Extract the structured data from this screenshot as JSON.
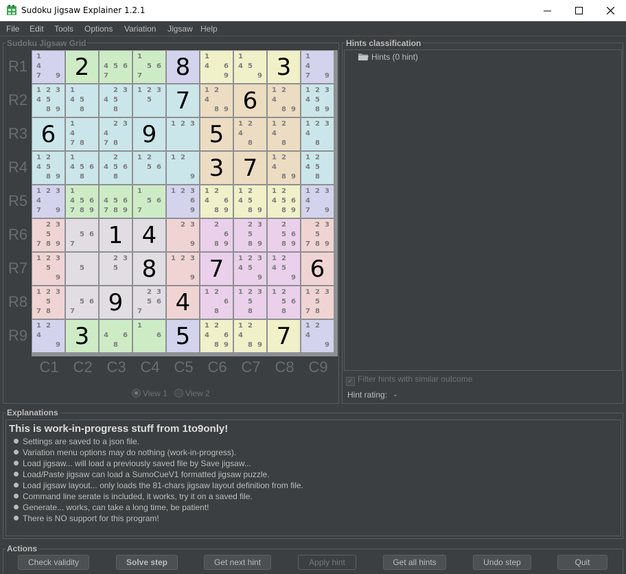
{
  "window": {
    "title": "Sudoku Jigsaw Explainer 1.2.1"
  },
  "menu": [
    "File",
    "Edit",
    "Tools",
    "Options",
    "Variation",
    "Jigsaw",
    "Help"
  ],
  "grid_panel": {
    "title": "Sudoku Jigsaw Grid",
    "rows": [
      "R1",
      "R2",
      "R3",
      "R4",
      "R5",
      "R6",
      "R7",
      "R8",
      "R9"
    ],
    "cols": [
      "C1",
      "C2",
      "C3",
      "C4",
      "C5",
      "C6",
      "C7",
      "C8",
      "C9"
    ],
    "view1": "View 1",
    "view2": "View 2"
  },
  "colors": {
    "lavender": "#d4d3ed",
    "green": "#cdecc6",
    "yellow": "#f0f0c9",
    "cyan": "#cbe6ea",
    "tan": "#ecdcc2",
    "pink": "#f0d4d3",
    "violet": "#ead0ea",
    "grey": "#e1dde2",
    "mint": "#d4ede5"
  },
  "cells": [
    [
      [
        "lavender",
        "",
        "1 4 7 9"
      ],
      [
        "green",
        "2",
        ""
      ],
      [
        "green",
        "",
        "4 5 6 7"
      ],
      [
        "green",
        "",
        "1 5 6 7"
      ],
      [
        "lavender",
        "8",
        ""
      ],
      [
        "yellow",
        "",
        "1 4 6 9"
      ],
      [
        "yellow",
        "",
        "1 4 5 9"
      ],
      [
        "yellow",
        "3",
        ""
      ],
      [
        "lavender",
        "",
        "1 4 7 9"
      ]
    ],
    [
      [
        "cyan",
        "",
        "1 2 3 4 5 8 9"
      ],
      [
        "cyan",
        "",
        "1 4 5 8"
      ],
      [
        "cyan",
        "",
        "2 3 4 5 8"
      ],
      [
        "cyan",
        "",
        "1 2 3 5"
      ],
      [
        "cyan",
        "7",
        ""
      ],
      [
        "tan",
        "",
        "1 2 4 8 9"
      ],
      [
        "tan",
        "6",
        ""
      ],
      [
        "tan",
        "",
        "1 2 4 8 9"
      ],
      [
        "cyan",
        "",
        "1 2 3 4 5 8 9"
      ]
    ],
    [
      [
        "cyan",
        "6",
        ""
      ],
      [
        "cyan",
        "",
        "1 4 7 8"
      ],
      [
        "cyan",
        "",
        "2 3 4 7 8"
      ],
      [
        "cyan",
        "9",
        ""
      ],
      [
        "cyan",
        "",
        "1 2 3"
      ],
      [
        "tan",
        "5",
        ""
      ],
      [
        "tan",
        "",
        "1 2 4 8"
      ],
      [
        "tan",
        "",
        "1 2 4 8"
      ],
      [
        "cyan",
        "",
        "1 2 3 4 8"
      ]
    ],
    [
      [
        "cyan",
        "",
        "1 2 4 5 8 9"
      ],
      [
        "cyan",
        "",
        "1 4 5 6 8"
      ],
      [
        "cyan",
        "",
        "2 4 5 6 8"
      ],
      [
        "cyan",
        "",
        "1 2 5 6"
      ],
      [
        "cyan",
        "",
        "1 2 9"
      ],
      [
        "tan",
        "3",
        ""
      ],
      [
        "tan",
        "7",
        ""
      ],
      [
        "tan",
        "",
        "1 2 4 8 9"
      ],
      [
        "cyan",
        "",
        "1 2 4 5 8"
      ]
    ],
    [
      [
        "lavender",
        "",
        "1 2 3 4 7 9"
      ],
      [
        "green",
        "",
        "1 4 5 6 7 8 9"
      ],
      [
        "green",
        "",
        "4 5 6 7 8 9"
      ],
      [
        "green",
        "",
        "1 5 6 7"
      ],
      [
        "lavender",
        "",
        "1 2 3 6 9"
      ],
      [
        "yellow",
        "",
        "1 2 4 6 8 9"
      ],
      [
        "yellow",
        "",
        "1 2 4 5 8 9"
      ],
      [
        "yellow",
        "",
        "1 2 4 5 6 8 9"
      ],
      [
        "lavender",
        "",
        "1 2 3 4 7 9"
      ]
    ],
    [
      [
        "pink",
        "",
        "2 3 5 7 8 9"
      ],
      [
        "grey",
        "",
        "5 6 7"
      ],
      [
        "grey",
        "1",
        ""
      ],
      [
        "grey",
        "4",
        ""
      ],
      [
        "pink",
        "",
        "2 3 9"
      ],
      [
        "violet",
        "",
        "2 6 8 9"
      ],
      [
        "violet",
        "",
        "2 3 5 8 9"
      ],
      [
        "violet",
        "",
        "2 5 6 8 9"
      ],
      [
        "pink",
        "",
        "2 3 5 7 8 9"
      ]
    ],
    [
      [
        "pink",
        "",
        "1 2 3 5 9"
      ],
      [
        "grey",
        "",
        "5"
      ],
      [
        "grey",
        "",
        "2 3 5"
      ],
      [
        "grey",
        "8",
        ""
      ],
      [
        "pink",
        "",
        "1 2 3 9"
      ],
      [
        "violet",
        "7",
        ""
      ],
      [
        "violet",
        "",
        "1 2 3 4 5 9"
      ],
      [
        "violet",
        "",
        "1 2 4 5 9"
      ],
      [
        "pink",
        "6",
        ""
      ]
    ],
    [
      [
        "pink",
        "",
        "1 2 3 5 7 8"
      ],
      [
        "grey",
        "",
        "5 6 7"
      ],
      [
        "grey",
        "9",
        ""
      ],
      [
        "grey",
        "",
        "2 3 5 6 7"
      ],
      [
        "pink",
        "4",
        ""
      ],
      [
        "violet",
        "",
        "1 2 6 8"
      ],
      [
        "violet",
        "",
        "1 2 3 5 8"
      ],
      [
        "violet",
        "",
        "1 2 5 6 8"
      ],
      [
        "pink",
        "",
        "1 2 3 5 7 8"
      ]
    ],
    [
      [
        "lavender",
        "",
        "1 2 4 9"
      ],
      [
        "green",
        "3",
        ""
      ],
      [
        "green",
        "",
        "4 6 8"
      ],
      [
        "green",
        "",
        "1 6"
      ],
      [
        "lavender",
        "5",
        ""
      ],
      [
        "yellow",
        "",
        "1 2 4 6 8 9"
      ],
      [
        "yellow",
        "",
        "1 2 4 8 9"
      ],
      [
        "yellow",
        "7",
        ""
      ],
      [
        "lavender",
        "",
        "1 2 4 9"
      ]
    ]
  ],
  "hints": {
    "title": "Hints classification",
    "root": "Hints (0 hint)",
    "filter_label": "Filter hints with similar outcome",
    "rating_label": "Hint rating:",
    "rating_value": "-"
  },
  "explanations": {
    "title": "Explanations",
    "heading": "This is work-in-progress stuff from 1to9only!",
    "items": [
      "Settings are saved to a json file.",
      "Variation menu options may do nothing (work-in-progress).",
      "Load jigsaw... will load a previously saved file by Save jigsaw...",
      "Load/Paste jigsaw can load a SumoCueV1 formatted jigsaw puzzle.",
      "Load jigsaw layout... only loads the 81-chars jigsaw layout definition from file.",
      "Command line serate is included, it works, try it on a saved file.",
      "Generate... works, can take a long time, be patient!",
      "There is NO support for this program!"
    ]
  },
  "actions": {
    "title": "Actions",
    "check": "Check validity",
    "solve": "Solve step",
    "next": "Get next hint",
    "apply": "Apply hint",
    "all": "Get all hints",
    "undo": "Undo step",
    "quit": "Quit"
  }
}
